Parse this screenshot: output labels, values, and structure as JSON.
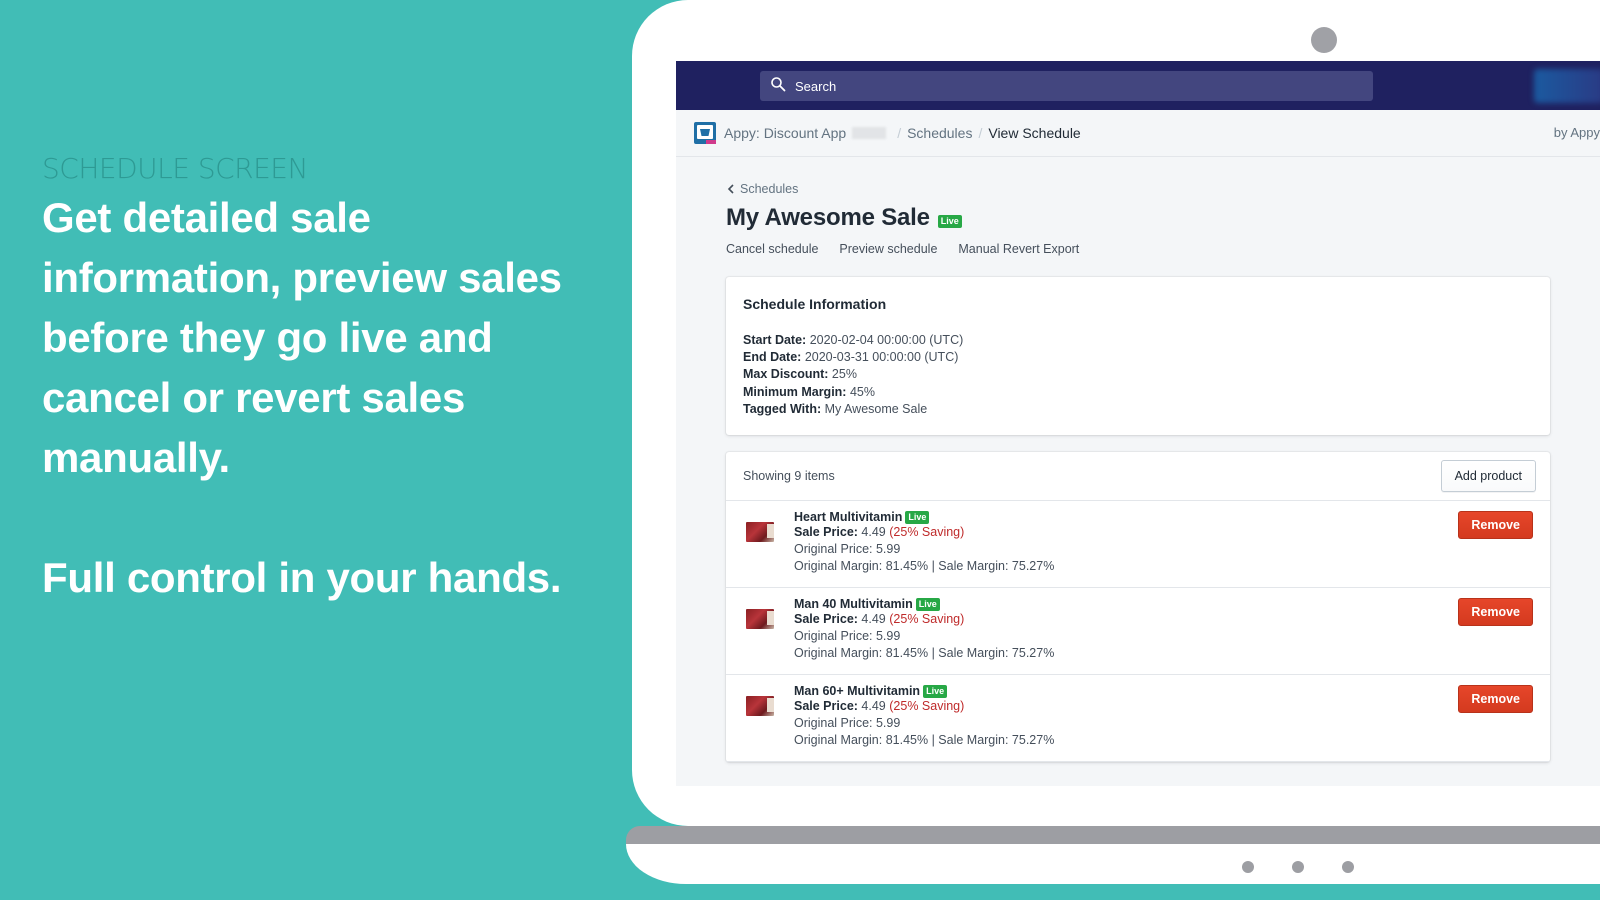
{
  "promo": {
    "eyebrow": "SCHEDULE SCREEN",
    "headline": "Get detailed sale information, preview sales before they go live and cancel or revert sales manually.",
    "tagline": "Full control in your hands."
  },
  "topbar": {
    "search_placeholder": "Search"
  },
  "breadcrumb": {
    "app_name": "Appy: Discount App",
    "items": [
      "Schedules",
      "View Schedule"
    ],
    "separator": "/",
    "by_label": "by Appy"
  },
  "page": {
    "back_label": "Schedules",
    "title": "My Awesome Sale",
    "status_badge": "Live",
    "actions": [
      "Cancel schedule",
      "Preview schedule",
      "Manual Revert Export"
    ]
  },
  "schedule_info": {
    "heading": "Schedule Information",
    "fields": [
      {
        "label": "Start Date:",
        "value": "2020-02-04 00:00:00 (UTC)"
      },
      {
        "label": "End Date:",
        "value": "2020-03-31 00:00:00 (UTC)"
      },
      {
        "label": "Max Discount:",
        "value": "25%"
      },
      {
        "label": "Minimum Margin:",
        "value": "45%"
      },
      {
        "label": "Tagged With:",
        "value": "My Awesome Sale"
      }
    ]
  },
  "items": {
    "count_label": "Showing 9 items",
    "add_button": "Add product",
    "remove_button": "Remove",
    "sale_price_label": "Sale Price:",
    "list": [
      {
        "name": "Heart Multivitamin",
        "badge": "Live",
        "sale_price": "4.49",
        "saving": "(25% Saving)",
        "original_price": "Original Price: 5.99",
        "margins": "Original Margin: 81.45% | Sale Margin: 75.27%"
      },
      {
        "name": "Man 40 Multivitamin",
        "badge": "Live",
        "sale_price": "4.49",
        "saving": "(25% Saving)",
        "original_price": "Original Price: 5.99",
        "margins": "Original Margin: 81.45% | Sale Margin: 75.27%"
      },
      {
        "name": "Man 60+ Multivitamin",
        "badge": "Live",
        "sale_price": "4.49",
        "saving": "(25% Saving)",
        "original_price": "Original Price: 5.99",
        "margins": "Original Margin: 81.45% | Sale Margin: 75.27%"
      }
    ]
  },
  "colors": {
    "background": "#41bdb6",
    "topbar": "#1f2160",
    "live_badge": "#27a846",
    "remove_button": "#d43a1f",
    "saving_text": "#bf2b2b"
  }
}
